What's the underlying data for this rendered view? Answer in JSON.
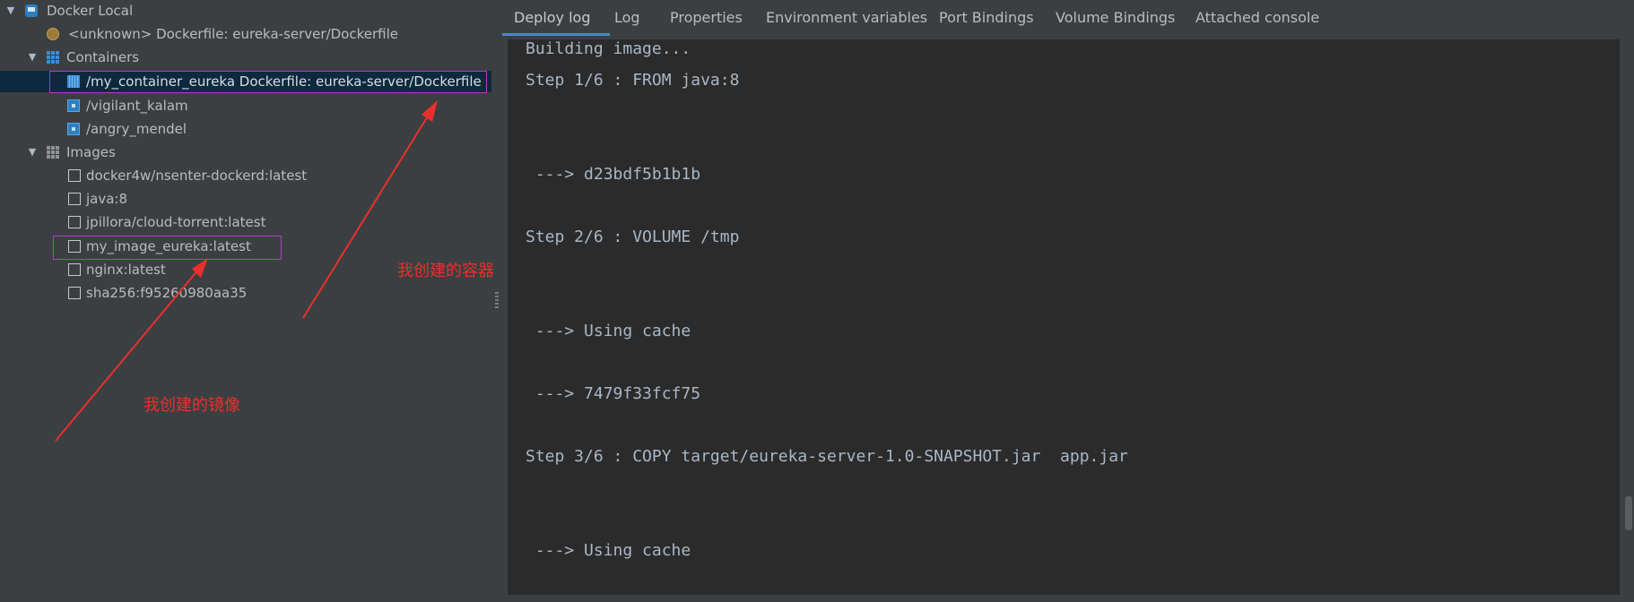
{
  "tree": {
    "root": "Docker Local",
    "unknown_item": "<unknown> Dockerfile: eureka-server/Dockerfile",
    "containers_label": "Containers",
    "containers": [
      "/my_container_eureka Dockerfile: eureka-server/Dockerfile",
      "/vigilant_kalam",
      "/angry_mendel"
    ],
    "images_label": "Images",
    "images": [
      "docker4w/nsenter-dockerd:latest",
      "java:8",
      "jpillora/cloud-torrent:latest",
      "my_image_eureka:latest",
      "nginx:latest",
      "sha256:f95260980aa35"
    ]
  },
  "annotations": {
    "container_note": "我创建的容器",
    "image_note": "我创建的镜像"
  },
  "tabs": [
    "Deploy log",
    "Log",
    "Properties",
    "Environment variables",
    "Port Bindings",
    "Volume Bindings",
    "Attached console"
  ],
  "active_tab": "Deploy log",
  "console_lines": [
    "Building image...",
    "Step 1/6 : FROM java:8",
    " ---> d23bdf5b1b1b",
    "Step 2/6 : VOLUME /tmp",
    " ---> Using cache",
    " ---> 7479f33fcf75",
    "Step 3/6 : COPY target/eureka-server-1.0-SNAPSHOT.jar  app.jar",
    " ---> Using cache"
  ],
  "colors": {
    "selection": "#0d293e",
    "outline": "#b03cc8",
    "annotation": "#e8302c",
    "tab_underline": "#4a88c7"
  }
}
